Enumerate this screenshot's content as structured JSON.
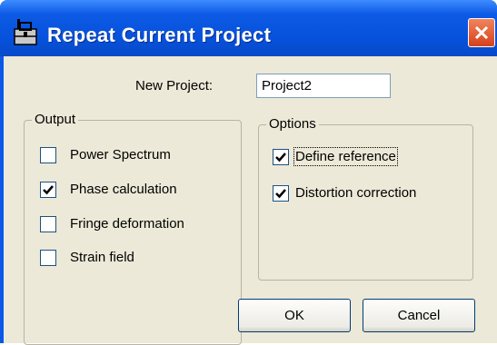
{
  "window": {
    "title": "Repeat Current Project",
    "icon": "toolbox-icon",
    "titlebar_color": "#0651dc",
    "face_color": "#ece9d8"
  },
  "form": {
    "new_project_label": "New Project:",
    "new_project_value": "Project2"
  },
  "output": {
    "legend": "Output",
    "items": [
      {
        "label": "Power Spectrum",
        "checked": false
      },
      {
        "label": "Phase calculation",
        "checked": true
      },
      {
        "label": "Fringe deformation",
        "checked": false
      },
      {
        "label": "Strain field",
        "checked": false
      }
    ]
  },
  "options": {
    "legend": "Options",
    "items": [
      {
        "label": "Define reference",
        "checked": true,
        "focused": true
      },
      {
        "label": "Distortion correction",
        "checked": true
      }
    ]
  },
  "buttons": {
    "ok": "OK",
    "cancel": "Cancel"
  }
}
